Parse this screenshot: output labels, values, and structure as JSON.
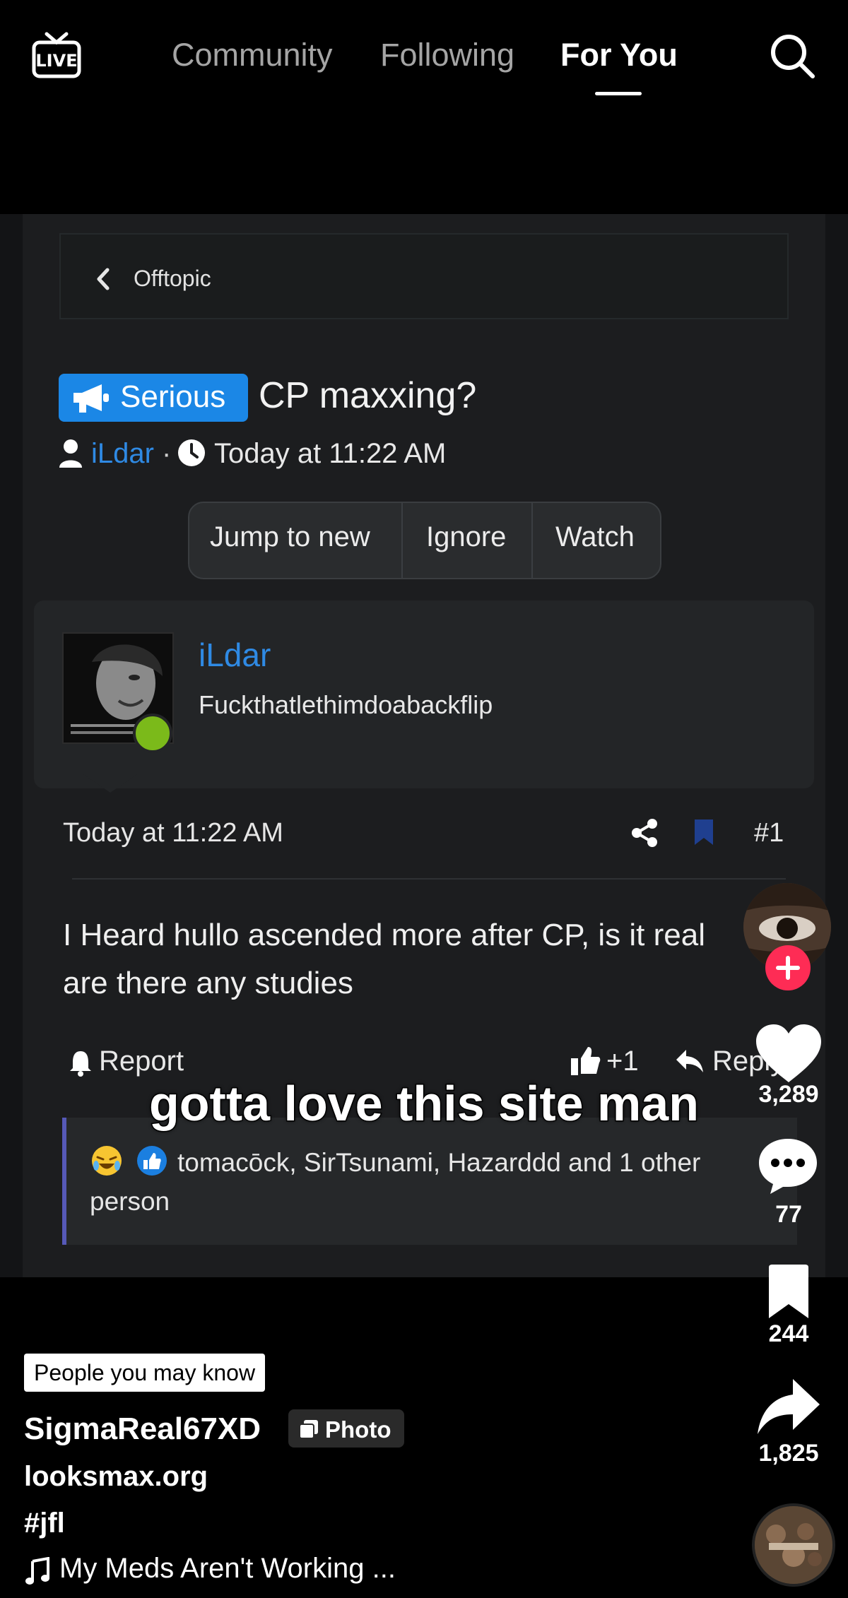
{
  "nav": {
    "tabs": [
      "Community",
      "Following",
      "For You"
    ],
    "active_tab": "For You",
    "live_icon": "live-icon",
    "search_icon": "search-icon"
  },
  "forum": {
    "breadcrumb": "Offtopic",
    "prefix_badge": "Serious",
    "thread_title": "CP maxxing?",
    "thread_author": "iLdar",
    "meta_separator": "·",
    "thread_time": "Today at 11:22 AM",
    "actions": [
      "Jump to new",
      "Ignore",
      "Watch"
    ],
    "post": {
      "author": "iLdar",
      "user_title": "Fuckthatlethimdoabackflip",
      "time": "Today at 11:22 AM",
      "number": "#1",
      "body": "I Heard hullo ascended more after CP, is it real are there any studies",
      "report_label": "Report",
      "like_count": "+1",
      "reply_label": "Reply",
      "reactions_text": "tomacōck, SirTsunami, Hazarddd and 1 other person"
    },
    "colors": {
      "link": "#2f8ae4",
      "badge": "#1b87e6",
      "online": "#7bba1a"
    }
  },
  "overlay_caption": "gotta love this site man",
  "rail": {
    "likes": "3,289",
    "comments": "77",
    "saves": "244",
    "shares": "1,825"
  },
  "info": {
    "tag": "People you may know",
    "creator": "SigmaReal67XD",
    "photo_badge": "Photo",
    "caption_line1": "looksmax.org",
    "caption_line2": "#jfl",
    "music": "My Meds Aren't Working ..."
  },
  "accent": {
    "follow": "#fe2c55"
  }
}
